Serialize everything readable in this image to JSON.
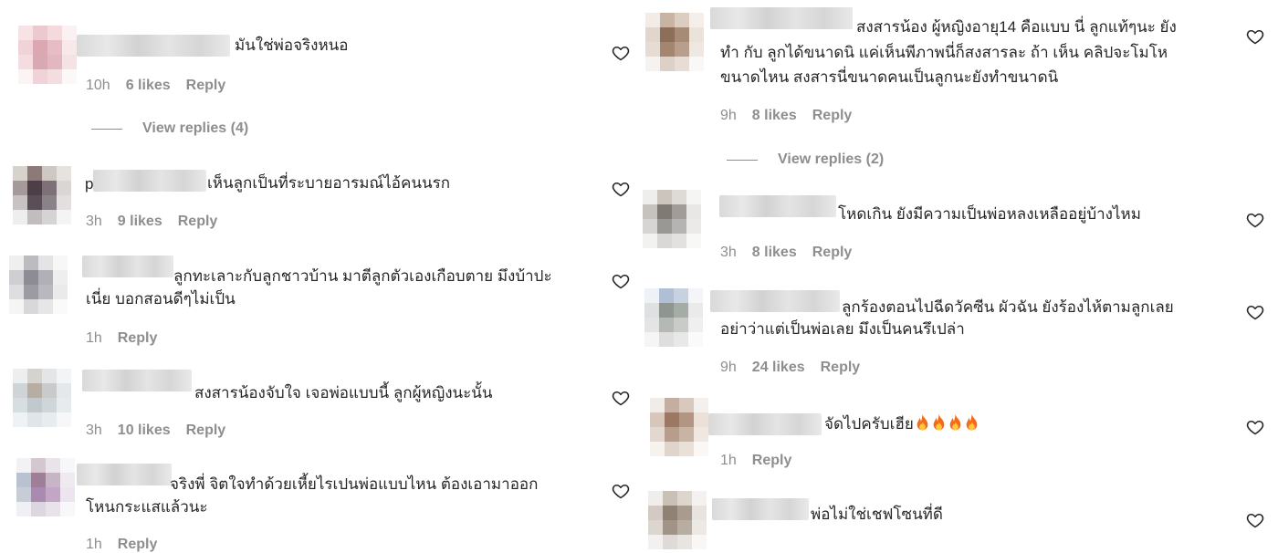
{
  "left": [
    {
      "text": "มันใช่พ่อจริงหนอ",
      "time": "10h",
      "likes": "6 likes",
      "reply": "Reply",
      "view_replies": "View replies (4)",
      "avatar": [
        "#f7e3e6",
        "#ecc9cf",
        "#f4dadd",
        "#fbf1f2",
        "#f0d3d8",
        "#dba8b2",
        "#e7bcc4",
        "#f8e8ea",
        "#f3dde0",
        "#d9a9b3",
        "#e3b7c0",
        "#f5e2e5",
        "#fbf3f4",
        "#efd3d8",
        "#f3dde1",
        "#fdf8f8"
      ]
    },
    {
      "text": "เห็นลูกเป็นที่ระบายอารมณ์ไอ้คนนรก",
      "prefix": "p",
      "time": "3h",
      "likes": "9 likes",
      "reply": "Reply",
      "avatar": [
        "#d8d2cc",
        "#8d7a78",
        "#cfc8c2",
        "#e6e3df",
        "#a59a99",
        "#4e3f46",
        "#7e7077",
        "#d9d6d4",
        "#c7c3c2",
        "#5b4e57",
        "#8b8289",
        "#e2dfde",
        "#efeeee",
        "#c1bdbe",
        "#d6d3d4",
        "#f4f4f4"
      ]
    },
    {
      "text": "ลูกทะเลาะกับลูกชาวบ้าน มาตีลูกตัวเองเกือบตาย มึงบ้าปะ",
      "text2": "เนี่ย บอกสอนดีๆไม่เป็น",
      "time": "1h",
      "likes": "",
      "reply": "Reply",
      "avatar": [
        "#efefef",
        "#bcbcc0",
        "#e4e4e6",
        "#f7f7f7",
        "#cfcfd3",
        "#8d8c95",
        "#b1b0b7",
        "#eeeeef",
        "#dedee1",
        "#9c9ba4",
        "#b9b8bf",
        "#eaeaec",
        "#f5f5f6",
        "#d8d8db",
        "#e6e6e8",
        "#fafafa"
      ]
    },
    {
      "text": "สงสารน้องจับใจ เจอพ่อแบบนี้ ลูกผู้หญิงนะนั้น",
      "time": "3h",
      "likes": "10 likes",
      "reply": "Reply",
      "avatar": [
        "#eceef0",
        "#d6d3cf",
        "#e4e5e6",
        "#f3f4f5",
        "#cfd4d8",
        "#b8ada2",
        "#c9cacb",
        "#e5e8ea",
        "#d7dee2",
        "#c1c9cf",
        "#cfd5d9",
        "#e6ebee",
        "#eef2f4",
        "#dfe5e8",
        "#e7ecef",
        "#f5f7f8"
      ]
    },
    {
      "text": "จริงพี่ จิตใจทำด้วยเหี้ยไรเปนพ่อแบบไหน ต้องเอามาออก",
      "text2": "โหนกระแสแล้วนะ",
      "time": "1h",
      "likes": "",
      "reply": "Reply",
      "avatar": [
        "#f2f2f4",
        "#d4c7d0",
        "#e8e4ea",
        "#f7f6f8",
        "#b9c2d0",
        "#9f7f96",
        "#c7b4c5",
        "#eeeaf0",
        "#c8ccd6",
        "#a98ab0",
        "#c3a6c6",
        "#ece5ef",
        "#eef0f3",
        "#dcd6e0",
        "#e8e2ea",
        "#f8f7f9"
      ]
    }
  ],
  "right": [
    {
      "text": "สงสารน้อง ผู้หญิงอายุ14 คือแบบ นี่ ลูกแท้ๆนะ ยัง",
      "text2": "ทำ กับ ลูกได้ขนาดนิ แค่เห็นพีภาพนี่ก็สงสารละ ถ้า เห็น คลิปจะโมโห",
      "text3": "ขนาดไหน สงสารนี่ขนาดคนเป็นลูกนะยังทำขนาดนิ",
      "time": "9h",
      "likes": "8 likes",
      "reply": "Reply",
      "view_replies": "View replies (2)",
      "avatar": [
        "#f1ece8",
        "#c9b4a4",
        "#dccdc1",
        "#f4efeb",
        "#e2d5cb",
        "#8c6e59",
        "#a68b77",
        "#ebe2da",
        "#e6dcd4",
        "#a48670",
        "#b89e8b",
        "#efe8e2",
        "#f6f2ef",
        "#ddd0c6",
        "#e8ddd4",
        "#faf8f6"
      ]
    },
    {
      "text": "โหดเกิน ยังมีความเป็นพ่อหลงเหลืออยู่บ้างไหม",
      "time": "3h",
      "likes": "8 likes",
      "reply": "Reply",
      "avatar": [
        "#eeeeec",
        "#cbc5bd",
        "#dedbd6",
        "#f5f5f4",
        "#c6c3bf",
        "#7f7a74",
        "#a19c97",
        "#e8e7e5",
        "#d6d5d3",
        "#9a9895",
        "#b5b4b2",
        "#eceae8",
        "#f2f2f1",
        "#d9d8d6",
        "#e2e1e0",
        "#f8f8f7"
      ]
    },
    {
      "text": "ลูกร้องตอนไปฉีดวัคซีน ผัวฉัน ยังร้องไห้ตามลูกเลย",
      "text2": "อย่าว่าแต่เป็นพ่อเลย มึงเป็นคนรึเปล่า",
      "time": "9h",
      "likes": "24 likes",
      "reply": "Reply",
      "avatar": [
        "#eef1f6",
        "#aebfd6",
        "#c7d1df",
        "#f3f5f8",
        "#dfe0e2",
        "#8f9690",
        "#a5aca6",
        "#e9eae9",
        "#e3e4e3",
        "#b5b9b5",
        "#c8cbc8",
        "#efefef",
        "#f5f5f5",
        "#dedede",
        "#e8e8e8",
        "#fafafa"
      ]
    },
    {
      "text": "จัดไปครับเฮีย",
      "fires": 4,
      "time": "1h",
      "likes": "",
      "reply": "Reply",
      "avatar": [
        "#f0ece8",
        "#c4aea0",
        "#d8c9be",
        "#f4f0ed",
        "#d7c6ba",
        "#9b7764",
        "#b39583",
        "#ebe1d9",
        "#e3d8cf",
        "#b69d8c",
        "#c8b3a4",
        "#efe7e0",
        "#f6f2ee",
        "#e0d5cc",
        "#e9e0d8",
        "#faf7f4"
      ]
    },
    {
      "text": "พ่อไม่ใช่เชฟโซนที่ดี",
      "time": "",
      "likes": "",
      "reply": "",
      "avatar": [
        "#f0eeeb",
        "#c9c0b6",
        "#dcd6cf",
        "#f4f2f0",
        "#d3cbc3",
        "#8f8173",
        "#a99b8d",
        "#e8e3de",
        "#dcd6d0",
        "#a19486",
        "#b8ada1",
        "#ece8e4",
        "#f3f1ef",
        "#dfdad5",
        "#e8e4e0",
        "#f8f7f6"
      ]
    }
  ],
  "partial_bottom": "1h   Reply"
}
